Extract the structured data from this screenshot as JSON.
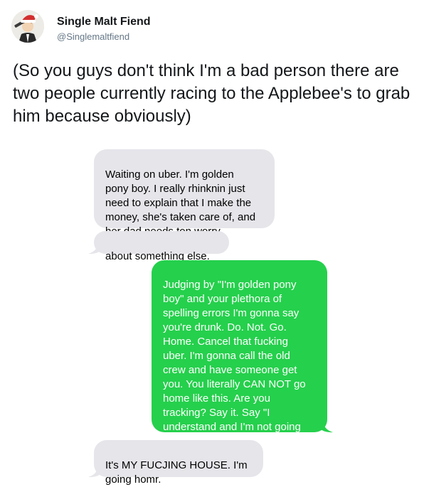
{
  "tweet": {
    "author_name": "Single Malt Fiend",
    "author_handle": "@Singlemaltfiend",
    "text": "(So you guys don't think I'm a bad person there are two people currently racing to the Applebee's to grab him because obviously)"
  },
  "messages": [
    {
      "sender": "received",
      "text": "Waiting on uber. I'm golden\npony boy. I really rhinknin just\nneed to explain that I make the\nmoney, she's taken care of, and\nher dad needs ton worry"
    },
    {
      "sender": "received",
      "text": "about something else."
    },
    {
      "sender": "sent",
      "text": "Judging by \"I'm golden pony\nboy\" and your plethora of\nspelling errors I'm gonna say\nyou're drunk. Do. Not. Go.\nHome. Cancel that fucking\nuber. I'm gonna call the old\ncrew and have someone get\nyou. You literally CAN NOT go\nhome like this. Are you\ntracking? Say it. Say \"I\nunderstand and I'm not going\nhome\". Right now. Say it."
    },
    {
      "sender": "received",
      "text": "It's MY FUCJING HOUSE. I'm\ngoing homr."
    }
  ],
  "colors": {
    "received_bubble": "#e5e5ea",
    "sent_bubble": "#25d04c"
  },
  "icons": {
    "avatar": "cartoon-man-in-santa-hat-avatar"
  }
}
